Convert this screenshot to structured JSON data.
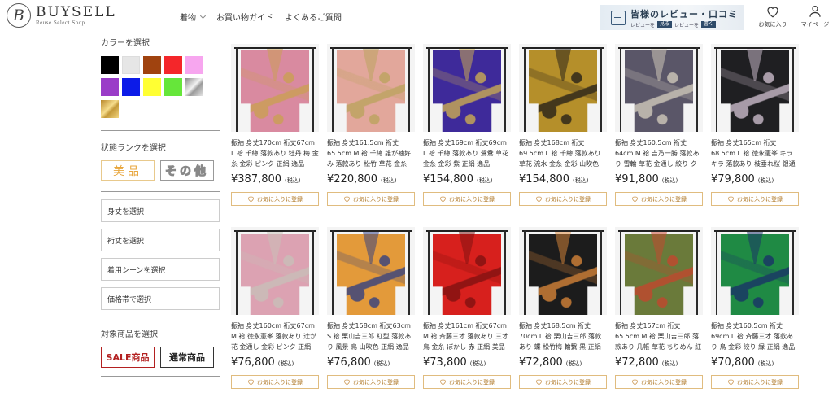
{
  "brand": {
    "name": "BUYSELL",
    "tagline": "Reuse Select Shop",
    "mark": "B"
  },
  "nav": [
    {
      "label": "着物",
      "has_dropdown": true
    },
    {
      "label": "お買い物ガイド",
      "has_dropdown": false
    },
    {
      "label": "よくあるご質問",
      "has_dropdown": false
    }
  ],
  "review_banner": {
    "title": "皆様のレビュー・口コミ",
    "sub_prefix": "レビューを",
    "view_btn": "見る",
    "sub_mid": "レビューを",
    "write_btn": "書く"
  },
  "header_icons": {
    "favorites": "お気に入り",
    "mypage": "マイページ",
    "favorites_icon": "heart-icon",
    "mypage_icon": "user-icon"
  },
  "sidebar": {
    "color_heading": "カラーを選択",
    "colors": [
      "#000000",
      "#e6e6e6",
      "#a0430f",
      "#f4262a",
      "#f7a6ef",
      "#9a3cc8",
      "#0c1be8",
      "#ffff33",
      "#66e63a",
      "silver",
      "gold"
    ],
    "rank_heading": "状態ランクを選択",
    "rank_good": "美品",
    "rank_other": "その他",
    "filters": [
      "身丈を選択",
      "裄丈を選択",
      "着用シーンを選択",
      "価格帯で選択"
    ],
    "target_heading": "対象商品を選択",
    "sale_label": "SALE商品",
    "normal_label": "通常商品"
  },
  "fav_label": "お気に入りに登録",
  "tax_label": "(税込)",
  "products": [
    {
      "desc": "振袖 身丈170cm 裄丈67cm L 袷 千總 落款あり 牡丹 梅 金糸 金彩 ピンク 正絹 逸品",
      "price": "¥387,800",
      "base": "#d98aa0",
      "accent": "#c9a04e"
    },
    {
      "desc": "振袖 身丈161.5cm 裄丈 65.5cm M 袷 千總 誰が袖好み 落款あり 松竹 草花 金糸 金彩",
      "price": "¥220,800",
      "base": "#e2a79b",
      "accent": "#b8a35a"
    },
    {
      "desc": "振袖 身丈169cm 裄丈69cm L 袷 千總 落款あり 鴛鴦 草花 金糸 金彩 紫 正絹 逸品",
      "price": "¥154,800",
      "base": "#3e2a9a",
      "accent": "#d6b64c"
    },
    {
      "desc": "振袖 身丈168cm 裄丈69.5cm L 袷 千總 落款あり 草花 流水 金糸 金彩 山吹色 正絹 逸品",
      "price": "¥154,800",
      "base": "#b58f2a",
      "accent": "#1e1a18"
    },
    {
      "desc": "振袖 身丈160.5cm 裄丈64cm M 袷 吉乃一勝 落款あり 雪輪 草花 金通し 絞り クリーム 正",
      "price": "¥91,800",
      "base": "#5a5668",
      "accent": "#d9d2c0"
    },
    {
      "desc": "振袖 身丈165cm 裄丈68.5cm L 袷 徳永憲峯 キラキラ 落款あり 枝垂れ桜 銀通し 黒 正絹",
      "price": "¥79,800",
      "base": "#1f1f22",
      "accent": "#d6c6d6"
    },
    {
      "desc": "振袖 身丈160cm 裄丈67cm M 袷 徳永憲峯 落款あり 辻が花 金通し 金彩 ピンク 正絹 美品 逸品",
      "price": "¥76,800",
      "base": "#dca2b2",
      "accent": "#c7c1b8"
    },
    {
      "desc": "振袖 身丈158cm 裄丈63cm S 袷 栗山吉三郎 紅型 落款あり 風景 鳥 山吹色 正絹 逸品",
      "price": "¥76,800",
      "base": "#e39a3a",
      "accent": "#273a86"
    },
    {
      "desc": "振袖 身丈161cm 裄丈67cm M 袷 斉藤三才 落款あり 三才鳥 金糸 ぼかし 赤 正絹 美品 逸品",
      "price": "¥73,800",
      "base": "#d7201d",
      "accent": "#7a1010"
    },
    {
      "desc": "振袖 身丈168.5cm 裄丈70cm L 袷 栗山吉三郎 落款あり 蝶 松竹梅 輪繋 黒 正絹 逸品",
      "price": "¥72,800",
      "base": "#1c1c1c",
      "accent": "#e08a3a"
    },
    {
      "desc": "振袖 身丈157cm 裄丈65.5cm M 袷 栗山吉三郎 落款あり 几帳 草花 ちりめん 紅型 灰緑 正",
      "price": "¥72,800",
      "base": "#6a7a3a",
      "accent": "#c9442e"
    },
    {
      "desc": "振袖 身丈160.5cm 裄丈69cm L 袷 斉藤三才 落款あり 鳥 金彩 絞り 緑 正絹 逸品",
      "price": "¥70,800",
      "base": "#1f8a44",
      "accent": "#1a2c6a"
    }
  ]
}
